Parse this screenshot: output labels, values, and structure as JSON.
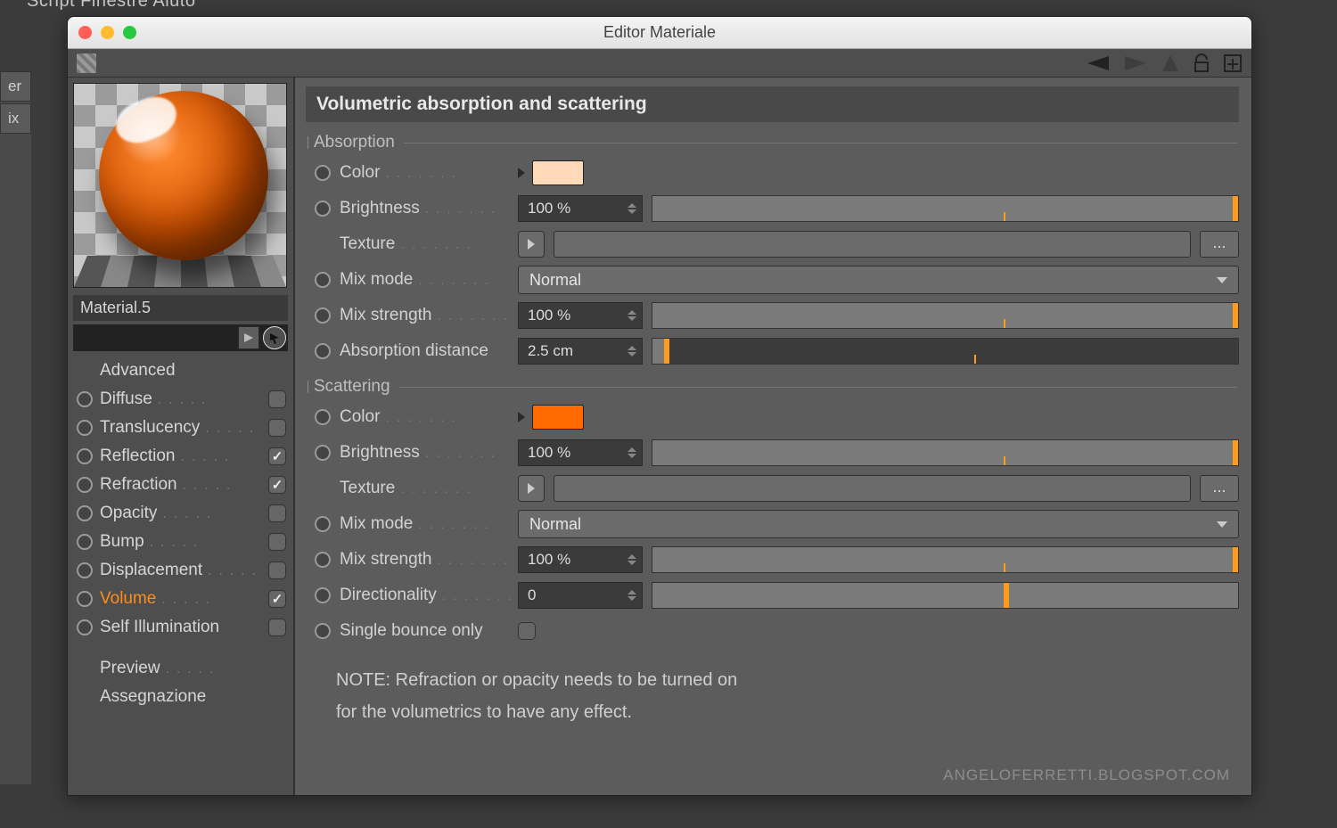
{
  "bg_menu": "Script    Finestre    Aiuto",
  "bg_tabs": [
    "er",
    "ix"
  ],
  "window": {
    "title": "Editor Materiale"
  },
  "material": {
    "name": "Material.5"
  },
  "channels": {
    "advanced": "Advanced",
    "items": [
      {
        "label": "Diffuse",
        "checked": false
      },
      {
        "label": "Translucency",
        "checked": false
      },
      {
        "label": "Reflection",
        "checked": true
      },
      {
        "label": "Refraction",
        "checked": true
      },
      {
        "label": "Opacity",
        "checked": false
      },
      {
        "label": "Bump",
        "checked": false
      },
      {
        "label": "Displacement",
        "checked": false
      },
      {
        "label": "Volume",
        "checked": true,
        "active": true
      },
      {
        "label": "Self Illumination",
        "checked": false
      }
    ],
    "preview": "Preview",
    "assegn": "Assegnazione"
  },
  "panel_header": "Volumetric absorption and scattering",
  "absorption": {
    "title": "Absorption",
    "color_label": "Color",
    "color_value": "#ffd9b8",
    "brightness_label": "Brightness",
    "brightness_value": "100 %",
    "texture_label": "Texture",
    "mixmode_label": "Mix mode",
    "mixmode_value": "Normal",
    "mixstrength_label": "Mix strength",
    "mixstrength_value": "100 %",
    "absdist_label": "Absorption distance",
    "absdist_value": "2.5 cm"
  },
  "scattering": {
    "title": "Scattering",
    "color_label": "Color",
    "color_value": "#ff6a00",
    "brightness_label": "Brightness",
    "brightness_value": "100 %",
    "texture_label": "Texture",
    "mixmode_label": "Mix mode",
    "mixmode_value": "Normal",
    "mixstrength_label": "Mix strength",
    "mixstrength_value": "100 %",
    "directionality_label": "Directionality",
    "directionality_value": "0",
    "singlebounce_label": "Single bounce only"
  },
  "note_line1": "NOTE: Refraction or opacity needs to be turned on",
  "note_line2": "for the volumetrics to have any effect.",
  "watermark": "ANGELOFERRETTI.BLOGSPOT.COM"
}
